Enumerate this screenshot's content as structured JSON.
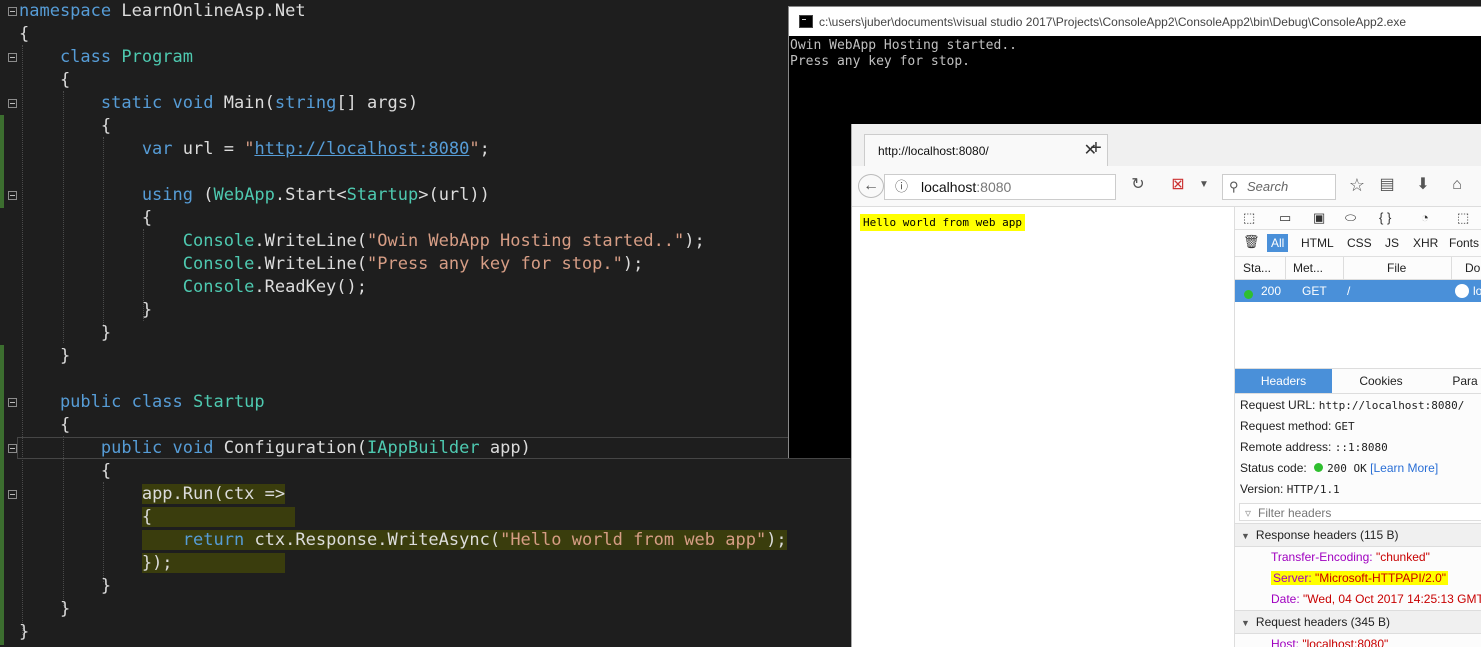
{
  "editor": {
    "lines": [
      [
        {
          "t": "namespace ",
          "c": "kw"
        },
        {
          "t": "LearnOnlineAsp.Net",
          "c": "tx"
        }
      ],
      [
        {
          "t": "{",
          "c": "tx"
        }
      ],
      [
        {
          "t": "    class ",
          "c": "kw"
        },
        {
          "t": "Program",
          "c": "ty"
        }
      ],
      [
        {
          "t": "    {",
          "c": "tx"
        }
      ],
      [
        {
          "t": "        static void ",
          "c": "kw"
        },
        {
          "t": "Main(",
          "c": "tx"
        },
        {
          "t": "string",
          "c": "kw"
        },
        {
          "t": "[] args)",
          "c": "tx"
        }
      ],
      [
        {
          "t": "        {",
          "c": "tx"
        }
      ],
      [
        {
          "t": "            var ",
          "c": "kw"
        },
        {
          "t": "url = ",
          "c": "tx"
        },
        {
          "t": "\"",
          "c": "st"
        },
        {
          "t": "http://localhost:8080",
          "c": "lk"
        },
        {
          "t": "\"",
          "c": "st"
        },
        {
          "t": ";",
          "c": "tx"
        }
      ],
      [],
      [
        {
          "t": "            using ",
          "c": "kw"
        },
        {
          "t": "(",
          "c": "tx"
        },
        {
          "t": "WebApp",
          "c": "ty"
        },
        {
          "t": ".Start<",
          "c": "tx"
        },
        {
          "t": "Startup",
          "c": "ty"
        },
        {
          "t": ">(url))",
          "c": "tx"
        }
      ],
      [
        {
          "t": "            {",
          "c": "tx"
        }
      ],
      [
        {
          "t": "                Console",
          "c": "ty"
        },
        {
          "t": ".WriteLine(",
          "c": "tx"
        },
        {
          "t": "\"Owin WebApp Hosting started..\"",
          "c": "st"
        },
        {
          "t": ");",
          "c": "tx"
        }
      ],
      [
        {
          "t": "                Console",
          "c": "ty"
        },
        {
          "t": ".WriteLine(",
          "c": "tx"
        },
        {
          "t": "\"Press any key for stop.\"",
          "c": "st"
        },
        {
          "t": ");",
          "c": "tx"
        }
      ],
      [
        {
          "t": "                Console",
          "c": "ty"
        },
        {
          "t": ".ReadKey();",
          "c": "tx"
        }
      ],
      [
        {
          "t": "            }",
          "c": "tx"
        }
      ],
      [
        {
          "t": "        }",
          "c": "tx"
        }
      ],
      [
        {
          "t": "    }",
          "c": "tx"
        }
      ],
      [],
      [
        {
          "t": "    public class ",
          "c": "kw"
        },
        {
          "t": "Startup",
          "c": "ty"
        }
      ],
      [
        {
          "t": "    {",
          "c": "tx"
        }
      ],
      [
        {
          "t": "        public void ",
          "c": "kw"
        },
        {
          "t": "Configuration",
          "c": "tx"
        },
        {
          "t": "(",
          "c": "tx"
        },
        {
          "t": "IAppBuilder",
          "c": "ty"
        },
        {
          "t": " app",
          "c": "tx"
        },
        {
          "t": ")",
          "c": "tx"
        }
      ],
      [
        {
          "t": "        {",
          "c": "tx"
        }
      ],
      [
        {
          "t": "            ",
          "c": "tx"
        },
        {
          "t": "app.Run(ctx =>",
          "c": "tx",
          "h": true
        }
      ],
      [
        {
          "t": "            ",
          "c": "tx"
        },
        {
          "t": "{              ",
          "c": "tx",
          "h": true
        }
      ],
      [
        {
          "t": "            ",
          "c": "tx"
        },
        {
          "t": "    ",
          "c": "tx",
          "h": true
        },
        {
          "t": "return ",
          "c": "kw",
          "h": true
        },
        {
          "t": "ctx.Response.WriteAsync(",
          "c": "tx",
          "h": true
        },
        {
          "t": "\"Hello world from web app\"",
          "c": "st",
          "h": true
        },
        {
          "t": ");",
          "c": "tx",
          "h": true
        }
      ],
      [
        {
          "t": "            ",
          "c": "tx"
        },
        {
          "t": "});           ",
          "c": "tx",
          "h": true
        }
      ],
      [
        {
          "t": "        }",
          "c": "tx"
        }
      ],
      [
        {
          "t": "    }",
          "c": "tx"
        }
      ],
      [
        {
          "t": "}",
          "c": "tx"
        }
      ]
    ]
  },
  "console": {
    "title": "c:\\users\\juber\\documents\\visual studio 2017\\Projects\\ConsoleApp2\\ConsoleApp2\\bin\\Debug\\ConsoleApp2.exe",
    "output": "Owin WebApp Hosting started..\nPress any key for stop."
  },
  "browser": {
    "tab_title": "http://localhost:8080/",
    "url_host": "localhost",
    "url_port": ":8080",
    "search_placeholder": "Search",
    "page_text": "Hello world from web app"
  },
  "devtools": {
    "filters": [
      "All",
      "HTML",
      "CSS",
      "JS",
      "XHR",
      "Fonts"
    ],
    "columns": [
      "Sta...",
      "Met...",
      "File",
      "Do"
    ],
    "request": {
      "status": "200",
      "method": "GET",
      "file": "/",
      "domain": "lo"
    },
    "subtabs": [
      "Headers",
      "Cookies",
      "Para"
    ],
    "summary": [
      {
        "k": "Request URL:",
        "v": "http://localhost:8080/"
      },
      {
        "k": "Request method:",
        "v": "GET"
      },
      {
        "k": "Remote address:",
        "v": "::1:8080"
      },
      {
        "k": "Status code:",
        "v": "200 OK",
        "learn": "[Learn More]"
      },
      {
        "k": "Version:",
        "v": "HTTP/1.1"
      }
    ],
    "filter_placeholder": "Filter headers",
    "response_section": "Response headers (115 B)",
    "response_headers": [
      {
        "k": "Transfer-Encoding:",
        "v": "\"chunked\""
      },
      {
        "k": "Server:",
        "v": "\"Microsoft-HTTPAPI/2.0\"",
        "highlight": true
      },
      {
        "k": "Date:",
        "v": "\"Wed, 04 Oct 2017 14:25:13 GMT\""
      }
    ],
    "request_section": "Request headers (345 B)",
    "request_headers": [
      {
        "k": "Host:",
        "v": "\"localhost:8080\""
      }
    ]
  },
  "colors": {
    "editor_bg": "#1e1e1e",
    "keyword": "#569cd6",
    "type": "#4ec9b0",
    "string": "#d69d85",
    "selection": "#4a90d9",
    "highlight": "#ffff00"
  }
}
